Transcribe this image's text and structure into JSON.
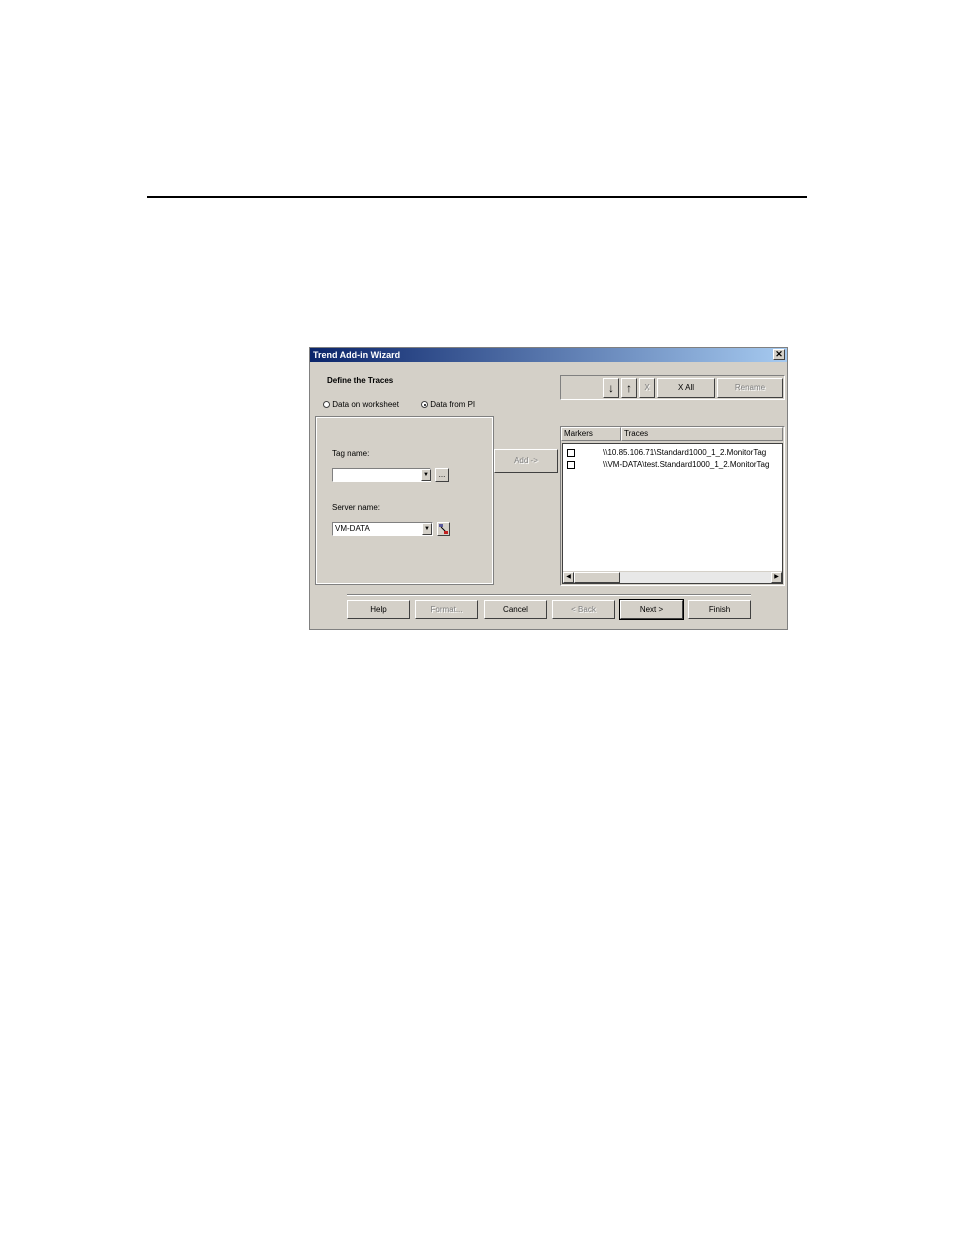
{
  "dialog": {
    "title": "Trend Add-in Wizard",
    "close_glyph": "✕",
    "heading": "Define the Traces"
  },
  "source": {
    "worksheet_label": "Data on worksheet",
    "pi_label": "Data from PI",
    "selected": "pi"
  },
  "tag": {
    "label": "Tag name:",
    "value": "",
    "browse_label": "..."
  },
  "server": {
    "label": "Server name:",
    "value": "VM-DATA"
  },
  "add_button": "Add ->",
  "toolbar": {
    "down_glyph": "↓",
    "up_glyph": "↑",
    "delete_label": "X",
    "delete_all_label": "X All",
    "rename_label": "Rename"
  },
  "traces_table": {
    "columns": [
      "Markers",
      "Traces"
    ],
    "rows": [
      {
        "marker_checked": false,
        "trace": "\\\\10.85.106.71\\Standard1000_1_2.MonitorTag"
      },
      {
        "marker_checked": false,
        "trace": "\\\\VM-DATA\\test.Standard1000_1_2.MonitorTag"
      }
    ]
  },
  "footer": {
    "help": "Help",
    "format": "Format...",
    "cancel": "Cancel",
    "back": "< Back",
    "next": "Next >",
    "finish": "Finish"
  },
  "colors": {
    "titlebar_start": "#0a246a",
    "titlebar_end": "#a6caf0",
    "dialog_face": "#d4d0c8"
  }
}
